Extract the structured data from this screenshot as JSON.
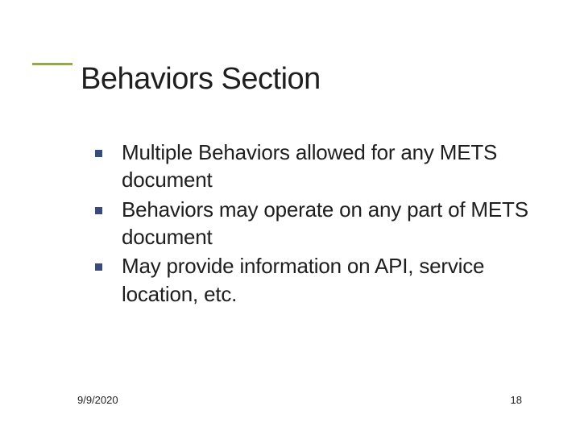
{
  "title": "Behaviors Section",
  "bullets": [
    "Multiple Behaviors allowed for any METS document",
    "Behaviors may operate on any part of METS document",
    "May provide information on API, service location, etc."
  ],
  "footer": {
    "date": "9/9/2020",
    "page": "18"
  }
}
